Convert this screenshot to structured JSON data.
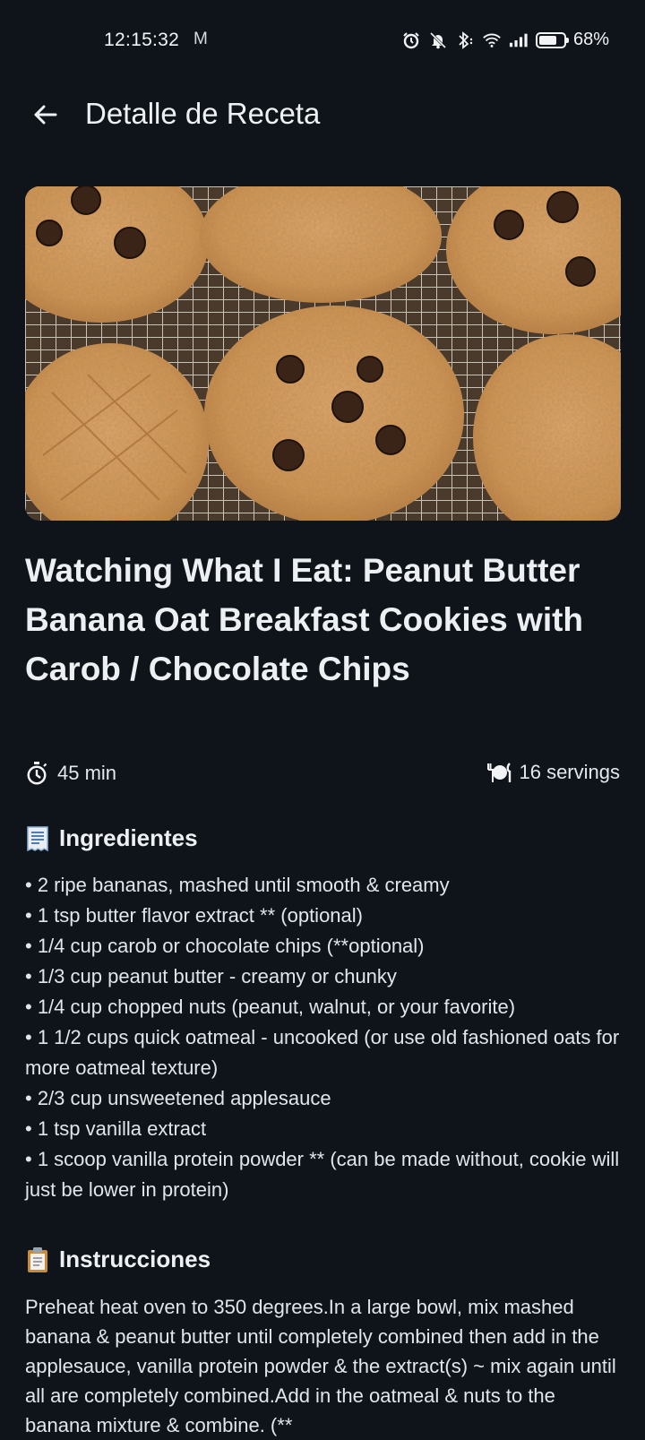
{
  "status_bar": {
    "time": "12:15:32",
    "mail_icon": "M",
    "battery": "68%"
  },
  "app_bar": {
    "title": "Detalle de Receta"
  },
  "recipe": {
    "title": "Watching What I Eat: Peanut Butter Banana Oat Breakfast Cookies with Carob / Chocolate Chips",
    "time": "45 min",
    "servings": "16 servings",
    "ingredients_heading": "Ingredientes",
    "ingredients": [
      "• 2 ripe bananas, mashed until smooth & creamy",
      "• 1 tsp butter flavor extract ** (optional)",
      "• 1/4 cup carob or chocolate chips (**optional)",
      "• 1/3 cup peanut butter - creamy or chunky",
      "• 1/4 cup chopped nuts (peanut, walnut, or your favorite)",
      "• 1 1/2 cups quick oatmeal - uncooked (or use old fashioned oats for more oatmeal texture)",
      "• 2/3 cup unsweetened applesauce",
      "• 1 tsp vanilla extract",
      "• 1 scoop vanilla protein powder ** (can be made without, cookie will just be lower in protein)"
    ],
    "instructions_heading": "Instrucciones",
    "instructions": "Preheat heat oven to 350 degrees.In a large bowl, mix mashed banana & peanut butter until completely combined then add in the applesauce, vanilla protein powder & the extract(s) ~ mix again until all are completely combined.Add in the oatmeal & nuts to the banana mixture & combine. (**"
  },
  "icons": {
    "time_icon": "stopwatch-icon",
    "servings_icon": "plate-icon",
    "ingredients_icon": "receipt-icon",
    "instructions_icon": "clipboard-icon"
  }
}
